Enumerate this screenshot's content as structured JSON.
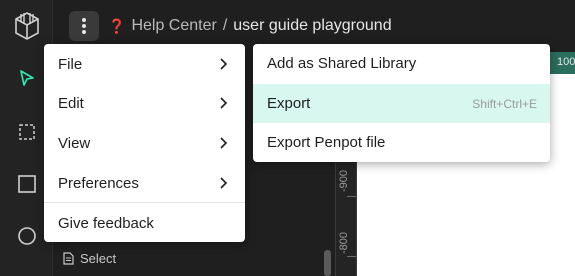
{
  "header": {
    "project": "Help Center",
    "separator": "/",
    "file": "user guide playground",
    "help_glyph": "❓"
  },
  "icons": {
    "logo": "penpot-logo-icon",
    "menu": "vertical-dots-icon",
    "move": "pointer-icon",
    "board": "board-icon",
    "rect": "rectangle-icon",
    "ellipse": "ellipse-icon",
    "layer": "page-icon",
    "chevron": "chevron-right-icon"
  },
  "colors": {
    "accent": "#31efb8",
    "hover_bg": "#d8f8ef",
    "ruler_accent": "#2a6e5e"
  },
  "main_menu": {
    "items": [
      {
        "label": "File",
        "submenu": true
      },
      {
        "label": "Edit",
        "submenu": true
      },
      {
        "label": "View",
        "submenu": true
      },
      {
        "label": "Preferences",
        "submenu": true
      },
      {
        "label": "Give feedback",
        "submenu": false
      }
    ]
  },
  "file_menu": {
    "items": [
      {
        "label": "Add as Shared Library",
        "shortcut": ""
      },
      {
        "label": "Export",
        "shortcut": "Shift+Ctrl+E"
      },
      {
        "label": "Export Penpot file",
        "shortcut": ""
      }
    ]
  },
  "layers": {
    "select_label": "Select"
  },
  "rulers": {
    "v_labels": [
      "-900",
      "-800"
    ],
    "h_accent_label": "100"
  }
}
